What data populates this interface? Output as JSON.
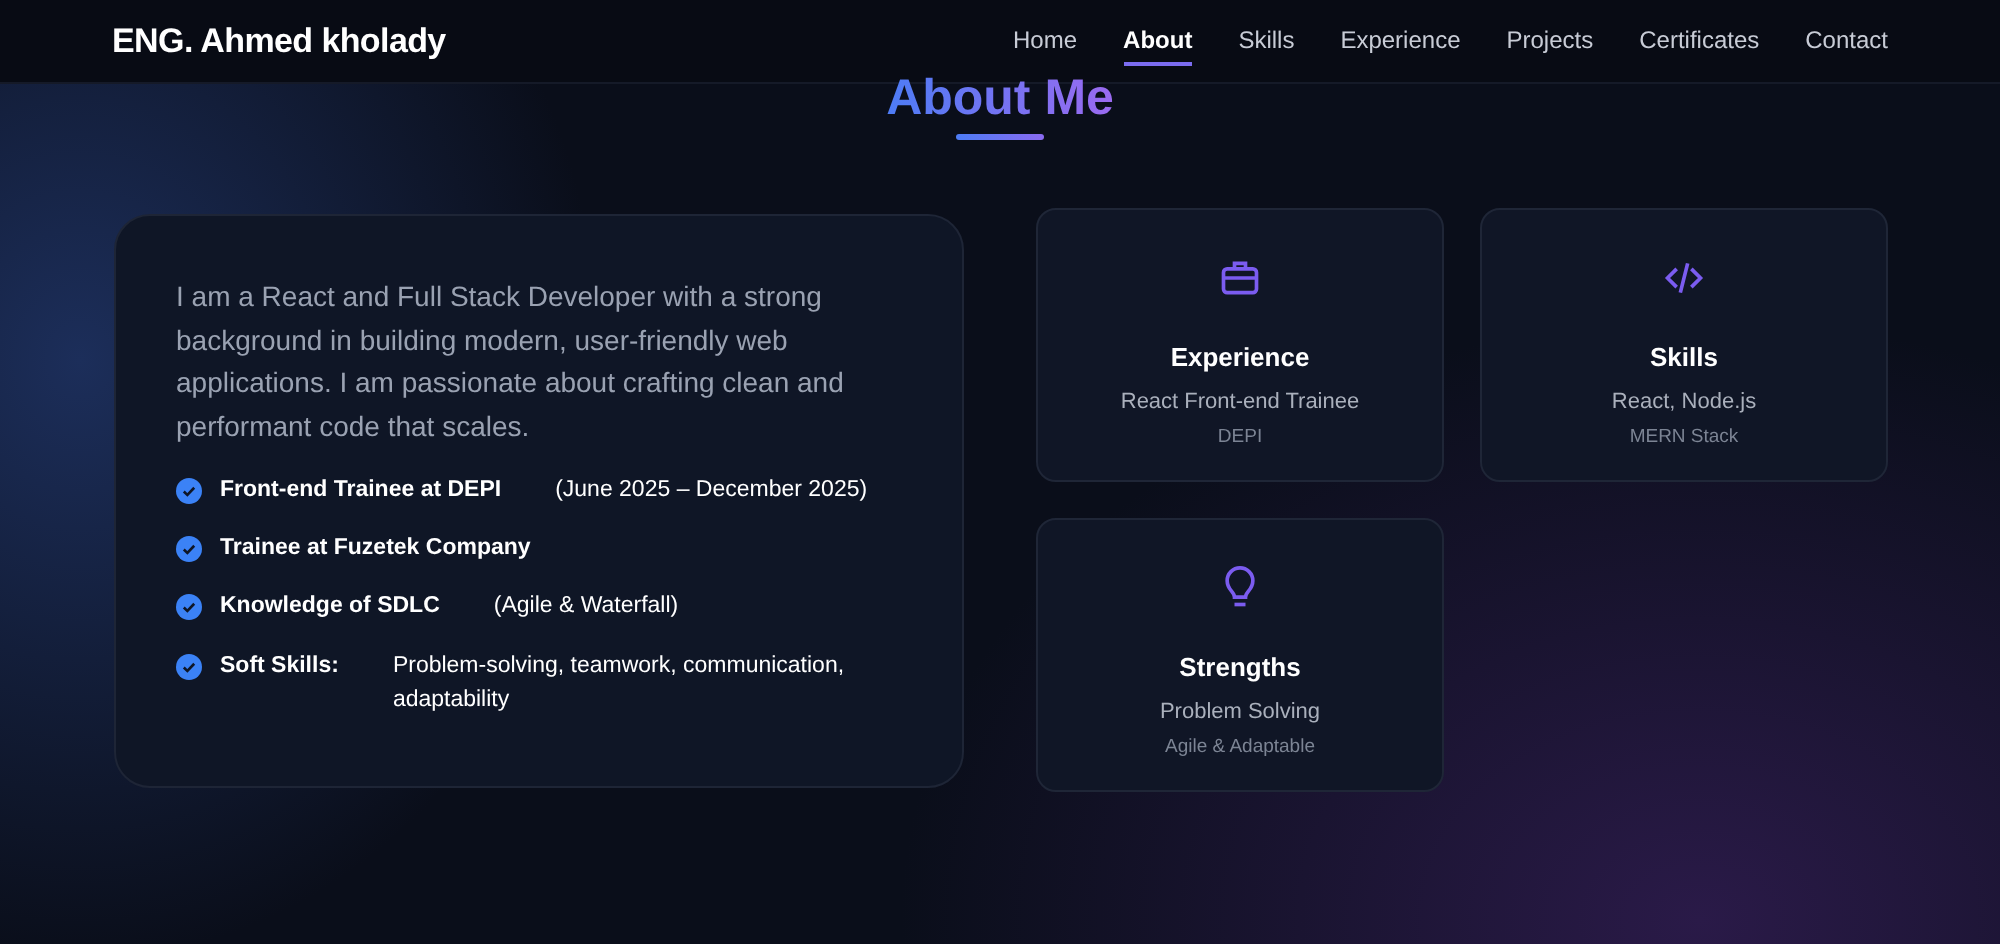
{
  "brand": "ENG. Ahmed kholady",
  "nav": [
    {
      "label": "Home",
      "selected": false
    },
    {
      "label": "About",
      "selected": true
    },
    {
      "label": "Skills",
      "selected": false
    },
    {
      "label": "Experience",
      "selected": false
    },
    {
      "label": "Projects",
      "selected": false
    },
    {
      "label": "Certificates",
      "selected": false
    },
    {
      "label": "Contact",
      "selected": false
    }
  ],
  "heading": "About Me",
  "intro": "I am a React and Full Stack Developer with a strong background in building modern, user-friendly web applications. I am passionate about crafting clean and performant code that scales.",
  "highlights": [
    {
      "title": "Front-end Trainee at DEPI",
      "detail": "(June 2025 – December 2025)"
    },
    {
      "title": "Trainee at Fuzetek Company"
    },
    {
      "title": "Knowledge of SDLC",
      "detail": "(Agile & Waterfall)"
    },
    {
      "title": "Soft Skills:",
      "detail": "Problem-solving, teamwork, communication, adaptability"
    }
  ],
  "cards": [
    {
      "title": "Experience",
      "subtitle": "React Front-end Trainee",
      "note": "DEPI"
    },
    {
      "title": "Skills",
      "subtitle": "React, Node.js",
      "note": "MERN Stack"
    },
    {
      "title": "Strengths",
      "subtitle": "Problem Solving",
      "note": "Agile & Adaptable"
    }
  ]
}
